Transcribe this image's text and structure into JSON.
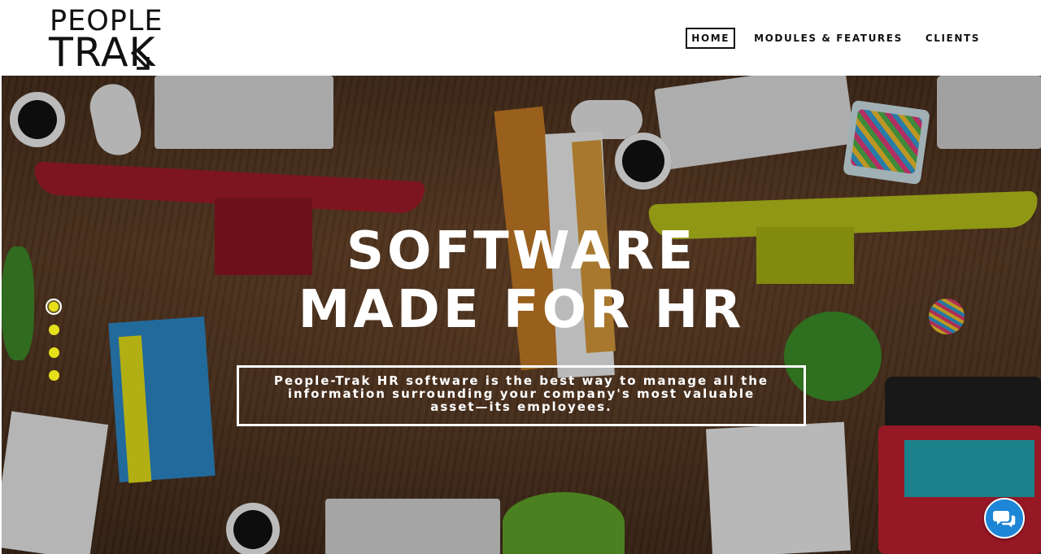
{
  "brand": {
    "line1": "PEOPLE",
    "line2": "TRAK",
    "logo_icon": "arrow-down-right-icon"
  },
  "nav": {
    "items": [
      {
        "label": "HOME",
        "active": true
      },
      {
        "label": "MODULES & FEATURES",
        "active": false
      },
      {
        "label": "CLIENTS",
        "active": false
      }
    ]
  },
  "hero": {
    "headline_line1": "SOFTWARE",
    "headline_line2": "MADE FOR HR",
    "tagline": "People-Trak HR software is the best way to manage all the information surrounding your company's most valuable asset—its employees.",
    "slides": {
      "count": 4,
      "active_index": 0
    }
  },
  "chat": {
    "icon": "chat-bubbles-icon"
  },
  "colors": {
    "accent_yellow": "#e5e01a",
    "chat_blue": "#1e86d6",
    "text_dark": "#111111"
  }
}
